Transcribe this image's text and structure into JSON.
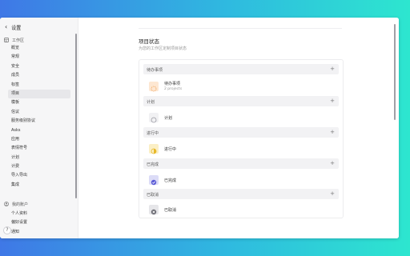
{
  "sidebar": {
    "back_label": "‹",
    "title": "设置",
    "workspace_section": "工作区",
    "workspace_items": [
      "概览",
      "常规",
      "安全",
      "成员",
      "标签",
      "项目",
      "模板",
      "信议",
      "服务级别协议",
      "Asks",
      "应用",
      "表情符号",
      "计划",
      "计费",
      "导入导出",
      "集成"
    ],
    "active_item": "项目",
    "account_section": "我的账户",
    "account_items": [
      "个人资料",
      "偏好设置",
      "通知"
    ],
    "help_label": "?"
  },
  "main": {
    "title": "项目状态",
    "subtitle": "为您的工作区定制项目状态",
    "groups": [
      {
        "name": "待办事项",
        "add": "+",
        "status": {
          "name": "待办事项",
          "sub": "2 projects",
          "icon": "backlog-icon",
          "bg": "#fde7d2",
          "color": "#f0a35a"
        }
      },
      {
        "name": "计划",
        "add": "+",
        "status": {
          "name": "计划",
          "sub": "",
          "icon": "planned-icon",
          "bg": "#f1f1f3",
          "color": "#9b9ba3"
        }
      },
      {
        "name": "进行中",
        "add": "+",
        "status": {
          "name": "进行中",
          "sub": "",
          "icon": "in-progress-icon",
          "bg": "#fbefc5",
          "color": "#e7b82a"
        }
      },
      {
        "name": "已完成",
        "add": "+",
        "status": {
          "name": "已完成",
          "sub": "",
          "icon": "completed-icon",
          "bg": "#dcdcf7",
          "color": "#5b5bd6"
        }
      },
      {
        "name": "已取消",
        "add": "+",
        "status": {
          "name": "已取消",
          "sub": "",
          "icon": "canceled-icon",
          "bg": "#e6e6e9",
          "color": "#6b6b73"
        }
      }
    ]
  }
}
